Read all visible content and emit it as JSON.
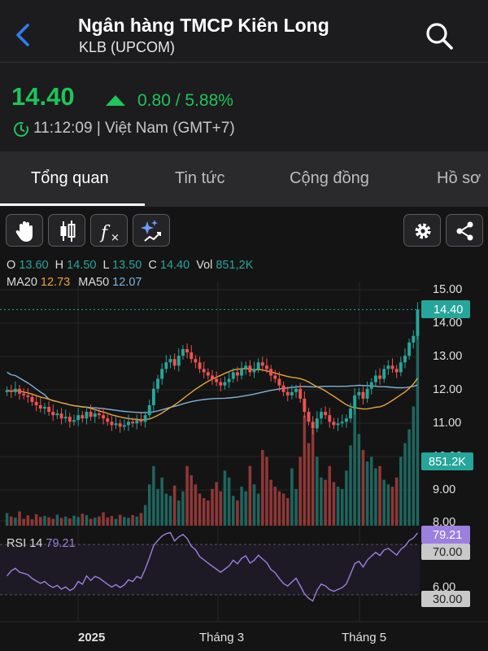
{
  "header": {
    "title": "Ngân hàng TMCP Kiên Long",
    "subtitle": "KLB (UPCOM)"
  },
  "quote": {
    "price": "14.40",
    "change": "0.80 / 5.88%",
    "time": "11:12:09 | Việt Nam (GMT+7)"
  },
  "tabs": [
    {
      "label": "Tổng quan",
      "active": true
    },
    {
      "label": "Tin tức",
      "active": false
    },
    {
      "label": "Cộng đồng",
      "active": false
    },
    {
      "label": "Hồ sơ",
      "active": false
    }
  ],
  "toolbar": {
    "tools": [
      "hand-icon",
      "candlestick-icon",
      "function-icon",
      "ai-sparkle-icon"
    ],
    "right": [
      "gear-icon",
      "share-icon"
    ]
  },
  "legend": {
    "o_label": "O",
    "o": "13.60",
    "h_label": "H",
    "h": "14.50",
    "l_label": "L",
    "l": "13.50",
    "c_label": "C",
    "c": "14.40",
    "vol_label": "Vol",
    "vol": "851,2K",
    "ma20_label": "MA20",
    "ma20": "12.73",
    "ma50_label": "MA50",
    "ma50": "12.07",
    "rsi_label": "RSI 14",
    "rsi": "79.21"
  },
  "badges": {
    "last_price": "14.40",
    "last_volume": "851.2K",
    "rsi_value": "79.21",
    "rsi_upper": "70.00",
    "rsi_lower": "30.00"
  },
  "colors": {
    "up": "#21c35b",
    "candle_up": "#26a69a",
    "candle_down": "#ef5350",
    "ma20": "#e8a33d",
    "ma50": "#7fb2d8",
    "rsi": "#9d7fe0"
  },
  "chart_data": {
    "type": "candlestick",
    "y_ticks": [
      "15.00",
      "14.00",
      "13.00",
      "12.00",
      "11.00",
      "10.00",
      "9.00",
      "8.00",
      "6.00"
    ],
    "y_range": [
      8.0,
      15.0
    ],
    "last_price_line": 14.4,
    "x_labels": [
      "2025",
      "Tháng 3",
      "Tháng 5"
    ],
    "rsi": {
      "period": 14,
      "upper": 70,
      "lower": 30,
      "last": 79.21
    },
    "closes": [
      11.95,
      11.9,
      12.0,
      11.85,
      11.8,
      11.75,
      11.6,
      11.5,
      11.4,
      11.45,
      11.3,
      11.2,
      11.25,
      11.1,
      11.15,
      11.0,
      11.05,
      11.2,
      11.1,
      11.3,
      11.15,
      11.25,
      11.2,
      11.1,
      11.0,
      10.9,
      10.95,
      10.85,
      10.9,
      11.0,
      10.95,
      11.05,
      11.0,
      11.2,
      11.5,
      12.0,
      12.3,
      12.6,
      12.8,
      12.9,
      12.7,
      13.0,
      13.2,
      13.1,
      12.9,
      12.8,
      12.6,
      12.5,
      12.4,
      12.3,
      12.2,
      12.1,
      12.2,
      12.3,
      12.5,
      12.4,
      12.6,
      12.7,
      12.5,
      12.6,
      12.8,
      12.7,
      12.6,
      12.4,
      12.3,
      12.1,
      11.9,
      11.8,
      11.9,
      12.0,
      11.7,
      11.3,
      11.0,
      10.8,
      11.1,
      11.3,
      11.2,
      11.0,
      10.9,
      10.95,
      11.0,
      11.1,
      11.4,
      11.8,
      11.9,
      11.7,
      12.0,
      12.2,
      12.4,
      12.3,
      12.6,
      12.7,
      12.6,
      12.5,
      12.8,
      13.0,
      13.4,
      13.6,
      14.4
    ],
    "volumes_k": [
      55,
      40,
      35,
      62,
      30,
      45,
      28,
      50,
      38,
      42,
      36,
      30,
      48,
      34,
      40,
      32,
      44,
      38,
      52,
      46,
      30,
      35,
      40,
      58,
      36,
      42,
      30,
      48,
      38,
      34,
      46,
      40,
      55,
      90,
      180,
      260,
      160,
      210,
      140,
      130,
      175,
      110,
      150,
      260,
      220,
      180,
      140,
      120,
      110,
      160,
      190,
      150,
      240,
      210,
      130,
      110,
      170,
      150,
      260,
      180,
      140,
      330,
      300,
      200,
      170,
      150,
      140,
      120,
      250,
      160,
      300,
      480,
      360,
      420,
      300,
      210,
      200,
      260,
      190,
      170,
      160,
      240,
      350,
      520,
      400,
      330,
      280,
      300,
      250,
      260,
      200,
      180,
      170,
      210,
      300,
      360,
      420,
      520,
      851.2
    ]
  }
}
